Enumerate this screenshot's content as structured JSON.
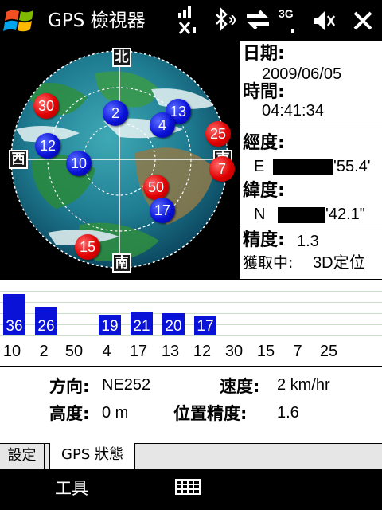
{
  "title_bar": {
    "app_title": "GPS 檢視器",
    "icons": [
      "windows-start-icon",
      "signal-off-icon",
      "bluetooth-icon",
      "data-sync-icon",
      "3g-signal-icon",
      "volume-mute-icon",
      "close-icon"
    ],
    "tray_3g": "3G",
    "close": "×"
  },
  "sky_view": {
    "directions": {
      "north": "北",
      "west": "西",
      "east": "東",
      "south": "南"
    },
    "satellites": [
      {
        "prn": "30",
        "color": "red"
      },
      {
        "prn": "2",
        "color": "blue"
      },
      {
        "prn": "13",
        "color": "blue"
      },
      {
        "prn": "4",
        "color": "blue"
      },
      {
        "prn": "25",
        "color": "red"
      },
      {
        "prn": "12",
        "color": "blue"
      },
      {
        "prn": "10",
        "color": "blue"
      },
      {
        "prn": "7",
        "color": "red"
      },
      {
        "prn": "50",
        "color": "red"
      },
      {
        "prn": "17",
        "color": "blue"
      },
      {
        "prn": "15",
        "color": "red"
      }
    ],
    "colors": {
      "in_use": "#0a12d8",
      "not_used": "#e00000"
    }
  },
  "info": {
    "date_label": "日期:",
    "date_value": "2009/06/05",
    "time_label": "時間:",
    "time_value": "04:41:34",
    "longitude_label": "經度:",
    "longitude_dir": "E",
    "longitude_tail": "'55.4'",
    "latitude_label": "緯度:",
    "latitude_dir": "N",
    "latitude_tail": "'42.1\"",
    "precision_label": "精度:",
    "precision_value": "1.3",
    "acquire_label": "獲取中:",
    "acquire_value": "3D定位"
  },
  "signal_bars": {
    "bars": [
      {
        "value": "36"
      },
      {
        "value": "26"
      },
      {
        "value": "19"
      },
      {
        "value": "21"
      },
      {
        "value": "20"
      },
      {
        "value": "17"
      }
    ],
    "prn_labels": [
      "10",
      "2",
      "50",
      "4",
      "17",
      "13",
      "12",
      "30",
      "15",
      "7",
      "25"
    ]
  },
  "status": {
    "direction_label": "方向:",
    "direction_value": "NE252",
    "speed_label": "速度:",
    "speed_value": "2 km/hr",
    "altitude_label": "高度:",
    "altitude_value": "0 m",
    "pos_precision_label": "位置精度:",
    "pos_precision_value": "1.6"
  },
  "tabs": [
    {
      "label": "設定",
      "active": false
    },
    {
      "label": "GPS 狀態",
      "active": true
    }
  ],
  "softkeys": {
    "left": "工具",
    "center_icon": "keyboard-icon"
  }
}
